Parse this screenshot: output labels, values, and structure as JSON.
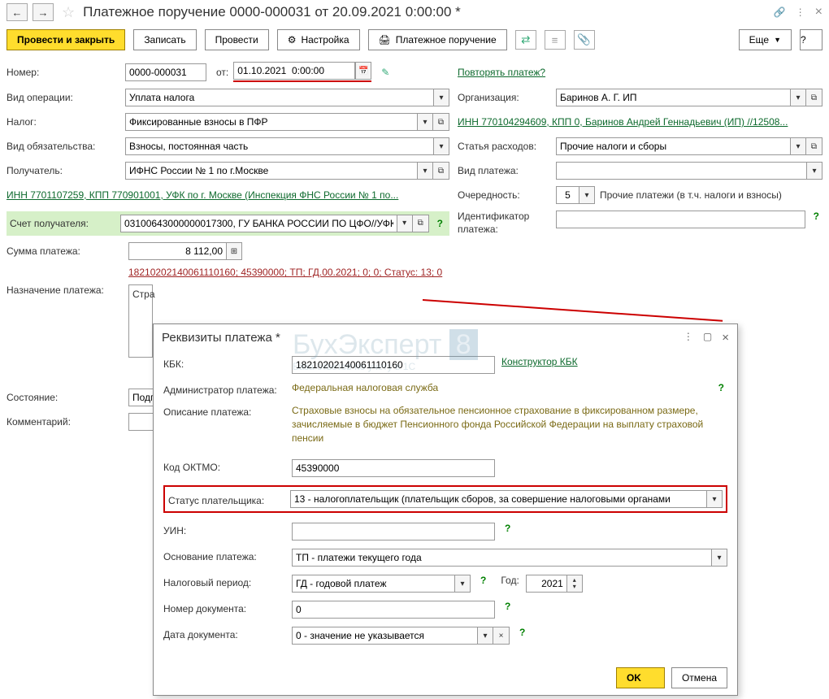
{
  "header": {
    "title": "Платежное поручение 0000-000031 от 20.09.2021 0:00:00 *"
  },
  "buttons": {
    "post_close": "Провести и закрыть",
    "save": "Записать",
    "post": "Провести",
    "settings": "Настройка",
    "print": "Платежное поручение",
    "more": "Еще",
    "question": "?"
  },
  "form": {
    "number_label": "Номер:",
    "number": "0000-000031",
    "date_label": "от:",
    "date": "01.10.2021  0:00:00",
    "repeat_link": "Повторять платеж?",
    "op_type_label": "Вид операции:",
    "op_type": "Уплата налога",
    "org_label": "Организация:",
    "org": "Баринов А. Г. ИП",
    "tax_label": "Налог:",
    "tax": "Фиксированные взносы в ПФР",
    "inn_link": "ИНН 770104294609, КПП 0, Баринов Андрей Геннадьевич (ИП) //12508...",
    "liability_label": "Вид обязательства:",
    "liability": "Взносы, постоянная часть",
    "expense_label": "Статья расходов:",
    "expense": "Прочие налоги и сборы",
    "recipient_label": "Получатель:",
    "recipient": "ИФНС России № 1 по г.Москве",
    "pay_type_label": "Вид платежа:",
    "pay_type": "",
    "inn_recipient_link": "ИНН 7701107259, КПП 770901001, УФК по г. Москве (Инспекция ФНС России № 1 по...",
    "priority_label": "Очередность:",
    "priority": "5",
    "priority_text": "Прочие платежи (в т.ч. налоги и взносы)",
    "account_label": "Счет получателя:",
    "account": "03100643000000017300, ГУ БАНКА РОССИИ ПО ЦФО//УФК",
    "identifier_label": "Идентификатор платежа:",
    "sum_label": "Сумма платежа:",
    "sum": "8 112,00",
    "details_link": "18210202140061110160; 45390000; ТП; ГД.00.2021; 0; 0; Статус: 13; 0",
    "purpose_label": "Назначение платежа:",
    "purpose_start": "Стра",
    "status_label": "Состояние:",
    "status": "Подг",
    "comment_label": "Комментарий:"
  },
  "modal": {
    "title": "Реквизиты платежа *",
    "kbk_label": "КБК:",
    "kbk": "18210202140061110160",
    "kbk_constructor": "Конструктор КБК",
    "admin_label": "Администратор платежа:",
    "admin": "Федеральная налоговая служба",
    "desc_label": "Описание платежа:",
    "desc": "Страховые взносы на обязательное пенсионное страхование в фиксированном размере, зачисляемые в бюджет Пенсионного фонда Российской Федерации на выплату страховой пенсии",
    "oktmo_label": "Код ОКТМО:",
    "oktmo": "45390000",
    "payer_status_label": "Статус плательщика:",
    "payer_status": "13 - налогоплательщик (плательщик сборов, за совершение налоговыми органами",
    "uin_label": "УИН:",
    "basis_label": "Основание платежа:",
    "basis": "ТП - платежи текущего года",
    "tax_period_label": "Налоговый период:",
    "tax_period": "ГД - годовой платеж",
    "year_label": "Год:",
    "year": "2021",
    "doc_num_label": "Номер документа:",
    "doc_num": "0",
    "doc_date_label": "Дата документа:",
    "doc_date": "0 - значение не указывается",
    "ok": "OK",
    "cancel": "Отмена"
  },
  "watermark": {
    "main": "БухЭксперт",
    "eight": "8",
    "sub": "База ответов по учету в 1С"
  }
}
